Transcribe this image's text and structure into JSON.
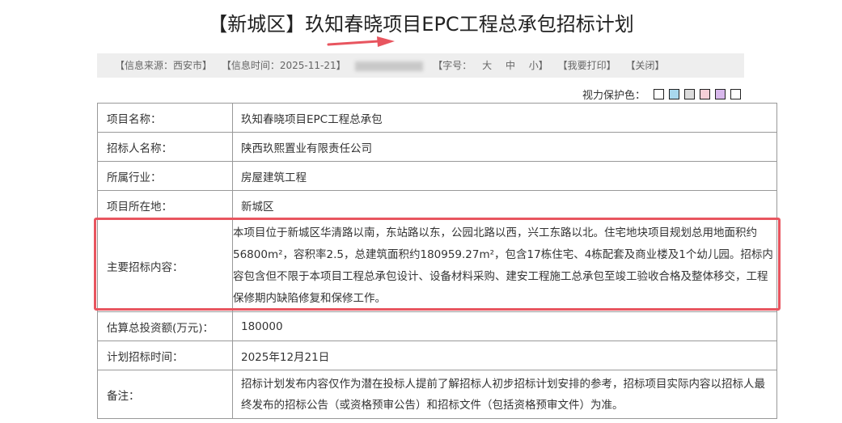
{
  "title": "【新城区】玖知春晓项目EPC工程总承包招标计划",
  "infobar": {
    "source": "【信息来源：西安市】",
    "time": "【信息时间：2025-11-21】",
    "font_size_label": "【字号：",
    "size_large": "大",
    "size_medium": "中",
    "size_small": "小】",
    "print": "【我要打印】",
    "close": "【关闭】"
  },
  "protect": {
    "label": "视力保护色：",
    "colors": [
      "#ffffff",
      "#a8d8ee",
      "#dcdcdc",
      "#f6d0d8",
      "#d8b8ec",
      "#ffffff"
    ]
  },
  "rows": [
    {
      "key": "项目名称：",
      "value": "玖知春晓项目EPC工程总承包"
    },
    {
      "key": "招标人名称：",
      "value": "陕西玖熙置业有限责任公司"
    },
    {
      "key": "所属行业：",
      "value": "房屋建筑工程"
    },
    {
      "key": "项目所在地：",
      "value": "新城区"
    },
    {
      "key": "主要招标内容：",
      "value": "本项目位于新城区华清路以南，东站路以东，公园北路以西，兴工东路以北。住宅地块项目规划总用地面积约56800m²，容积率2.5，总建筑面积约180959.27m²，包含17栋住宅、4栋配套及商业楼及1个幼儿园。招标内容包含但不限于本项目工程总承包设计、设备材料采购、建安工程施工总承包至竣工验收合格及整体移交，工程保修期内缺陷修复和保修工作。"
    },
    {
      "key": "估算总投资额(万元)：",
      "value": "180000"
    },
    {
      "key": "计划招标时间：",
      "value": "2025年12月21日"
    },
    {
      "key": "备注：",
      "value": "招标计划发布内容仅作为潜在投标人提前了解招标人初步招标计划安排的参考，招标项目实际内容以招标人最终发布的招标公告（或资格预审公告）和招标文件（包括资格预审文件）为准。"
    }
  ],
  "accent_colors": {
    "highlight_border": "#e8555f",
    "arrow": "#e8555f"
  }
}
